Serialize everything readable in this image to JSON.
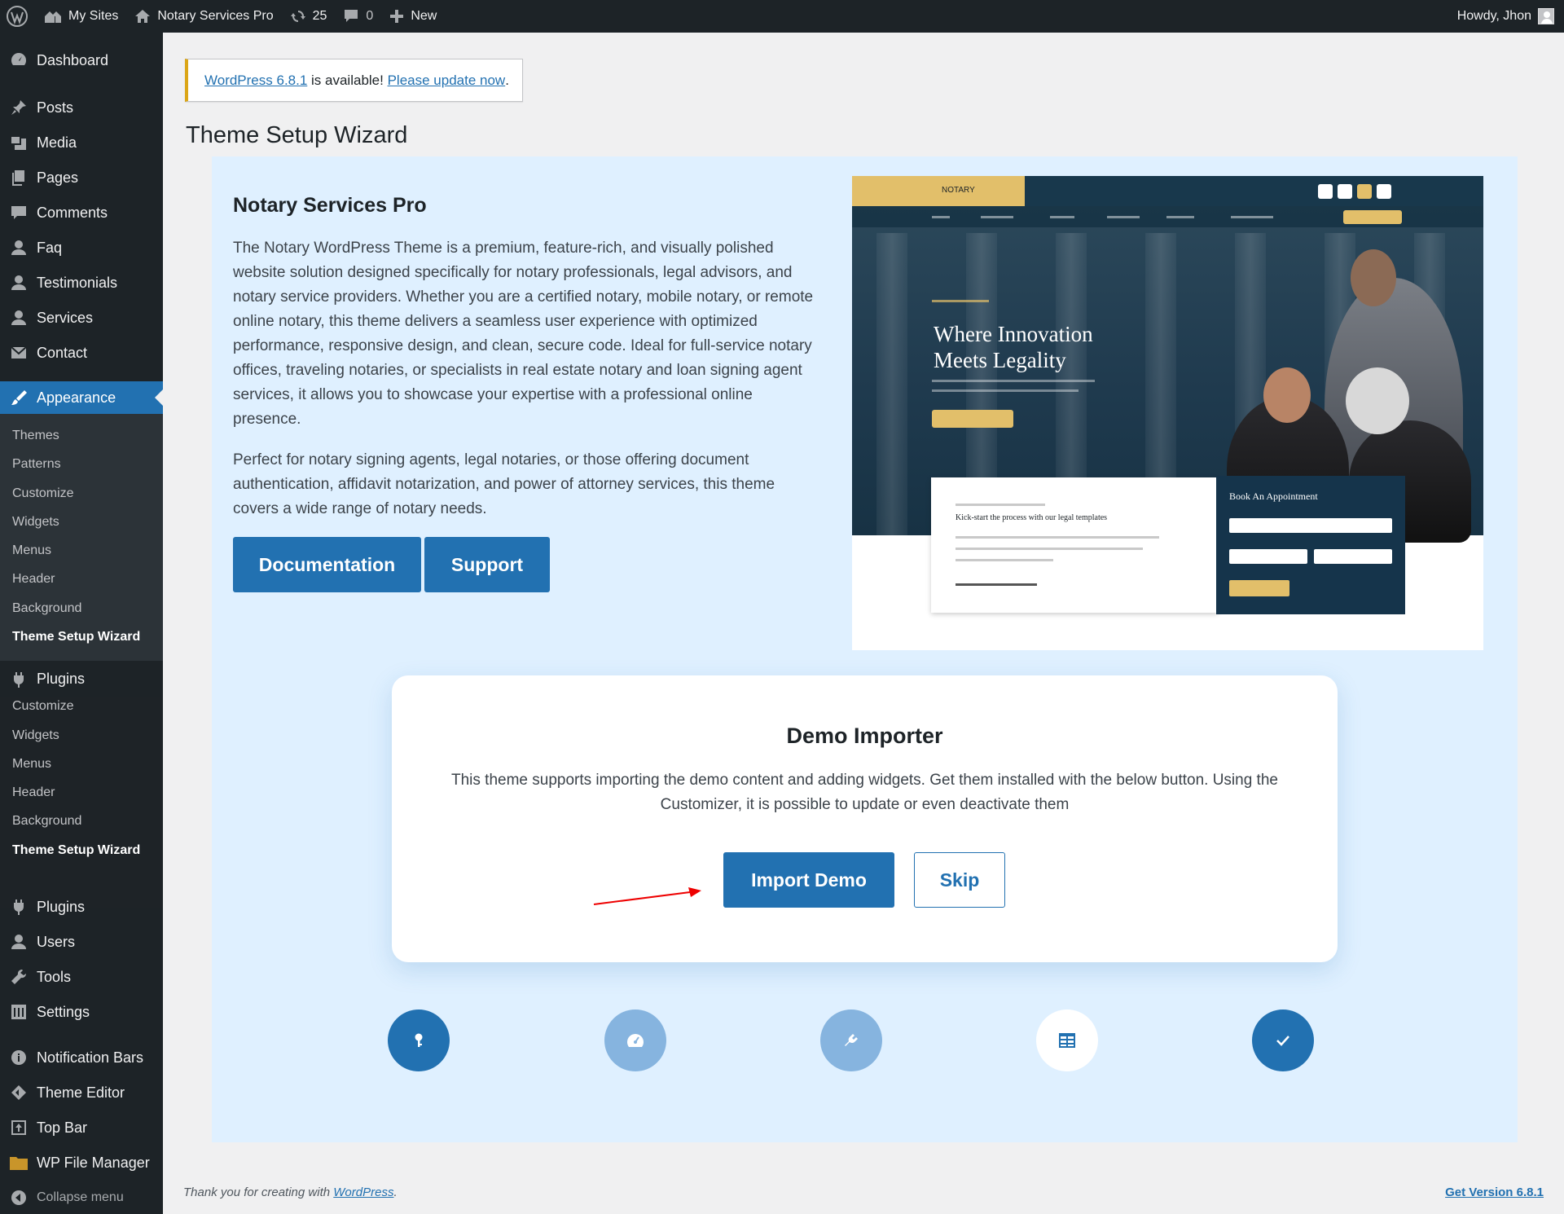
{
  "adminbar": {
    "my_sites": "My Sites",
    "site_name": "Notary Services Pro",
    "updates_count": "25",
    "comments_count": "0",
    "new_label": "New",
    "howdy": "Howdy, Jhon"
  },
  "sidebar": {
    "items_top": [
      {
        "label": "Dashboard",
        "icon": "dashboard-icon"
      },
      {
        "label": "Posts",
        "icon": "pin-icon"
      },
      {
        "label": "Media",
        "icon": "media-icon"
      },
      {
        "label": "Pages",
        "icon": "pages-icon"
      },
      {
        "label": "Comments",
        "icon": "comments-icon"
      },
      {
        "label": "Faq",
        "icon": "user-icon"
      },
      {
        "label": "Testimonials",
        "icon": "user-icon"
      },
      {
        "label": "Services",
        "icon": "user-icon"
      },
      {
        "label": "Contact",
        "icon": "email-icon"
      }
    ],
    "appearance": "Appearance",
    "appearance_sub": [
      "Themes",
      "Patterns",
      "Customize",
      "Widgets",
      "Menus",
      "Header",
      "Background",
      "Theme Setup Wizard"
    ],
    "plugins_flyout": "Plugins",
    "flyout_sub": [
      "Customize",
      "Widgets",
      "Menus",
      "Header",
      "Background",
      "Theme Setup Wizard"
    ],
    "items_bottom": [
      {
        "label": "Plugins",
        "icon": "plugins-icon"
      },
      {
        "label": "Users",
        "icon": "user-icon"
      },
      {
        "label": "Tools",
        "icon": "wrench-icon"
      },
      {
        "label": "Settings",
        "icon": "settings-icon"
      }
    ],
    "items_extra": [
      {
        "label": "Notification Bars",
        "icon": "info-icon"
      },
      {
        "label": "Theme Editor",
        "icon": "theme-editor-icon"
      },
      {
        "label": "Top Bar",
        "icon": "top-bar-icon"
      },
      {
        "label": "WP File Manager",
        "icon": "folder-icon"
      },
      {
        "label": "Collapse menu",
        "icon": "collapse-icon"
      }
    ]
  },
  "notice": {
    "link1": "WordPress 6.8.1",
    "text": " is available! ",
    "link2": "Please update now",
    "end": "."
  },
  "page_title": "Theme Setup Wizard",
  "theme": {
    "name": "Notary Services Pro",
    "paragraph1": "The Notary WordPress Theme is a premium, feature-rich, and visually polished website solution designed specifically for notary professionals, legal advisors, and notary service providers. Whether you are a certified notary, mobile notary, or remote online notary, this theme delivers a seamless user experience with optimized performance, responsive design, and clean, secure code. Ideal for full-service notary offices, traveling notaries, or specialists in real estate notary and loan signing agent services, it allows you to showcase your expertise with a professional online presence.",
    "paragraph2": "Perfect for notary signing agents, legal notaries, or those offering document authentication, affidavit notarization, and power of attorney services, this theme covers a wide range of notary needs.",
    "documentation": "Documentation",
    "support": "Support"
  },
  "preview": {
    "logo": "NOTARY",
    "headline1": "Where Innovation",
    "headline2": "Meets Legality",
    "form_title": "Book An Appointment",
    "card_title": "Kick-start the process with our legal templates"
  },
  "demo": {
    "title": "Demo Importer",
    "description": "This theme supports importing the demo content and adding widgets. Get them installed with the below button. Using the Customizer, it is possible to update or even deactivate them",
    "import": "Import Demo",
    "skip": "Skip"
  },
  "steps": [
    {
      "icon": "key-icon",
      "state": "done"
    },
    {
      "icon": "gauge-icon",
      "state": "pending"
    },
    {
      "icon": "plugins-icon",
      "state": "pending"
    },
    {
      "icon": "layout-icon",
      "state": "current"
    },
    {
      "icon": "check-icon",
      "state": "done"
    }
  ],
  "footer": {
    "thanks": "Thank you for creating with ",
    "wp_link": "WordPress",
    "end": ".",
    "version": "Get Version 6.8.1"
  },
  "colors": {
    "admin_bg": "#1d2327",
    "accent": "#2271b1",
    "panel_bg": "#dff0ff",
    "notice_warning": "#dba617",
    "preview_gold": "#e2bf6a"
  }
}
